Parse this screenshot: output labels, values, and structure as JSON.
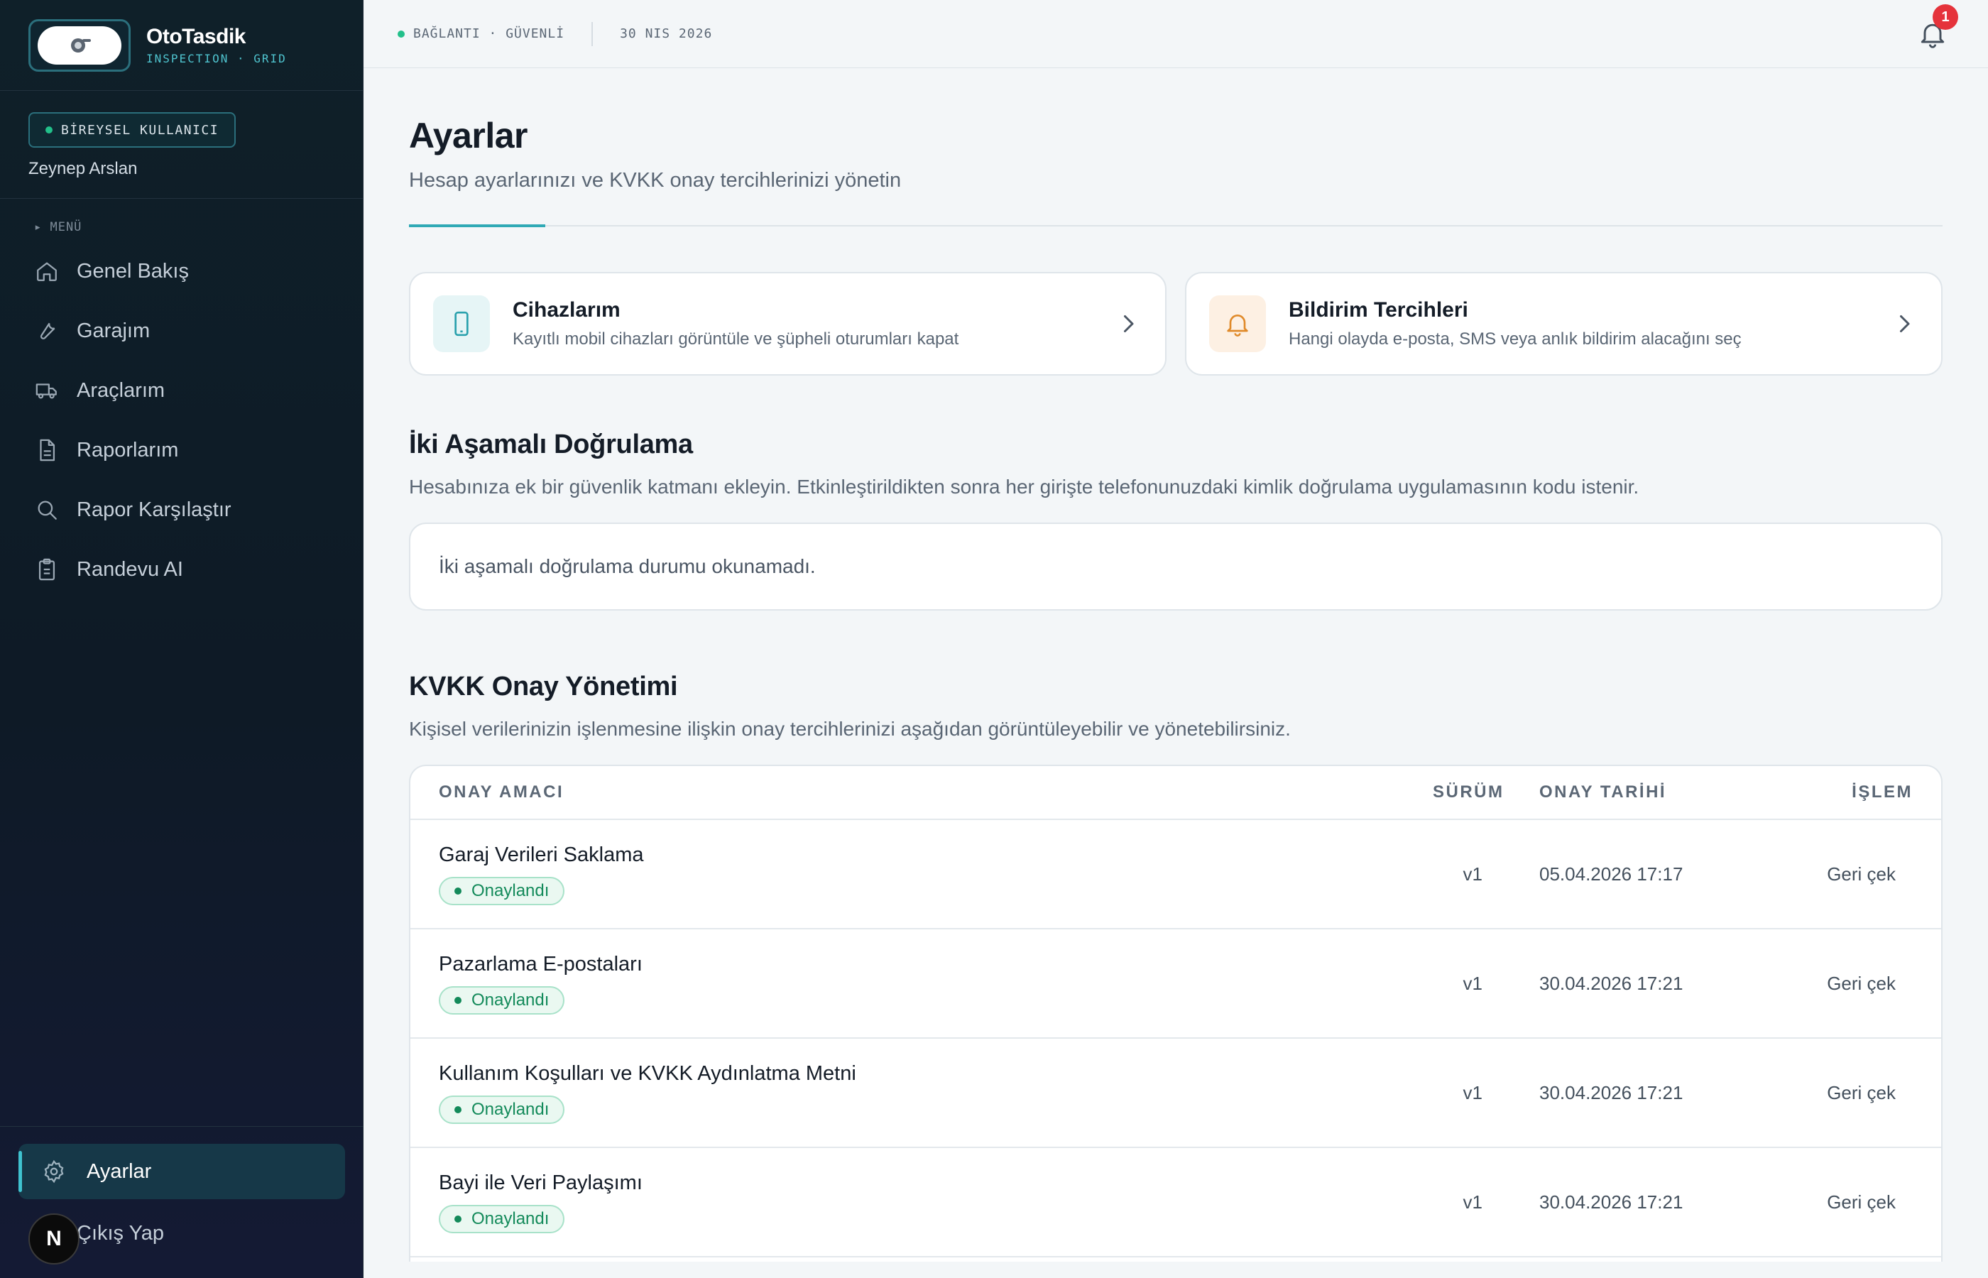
{
  "brand": {
    "name": "OtoTasdik",
    "tagline": "INSPECTION · GRID"
  },
  "user": {
    "role": "BİREYSEL KULLANICI",
    "name": "Zeynep Arslan"
  },
  "menu": {
    "label": "▸ MENÜ",
    "items": [
      {
        "label": "Genel Bakış",
        "icon": "home-icon"
      },
      {
        "label": "Garajım",
        "icon": "wrench-icon"
      },
      {
        "label": "Araçlarım",
        "icon": "truck-icon"
      },
      {
        "label": "Raporlarım",
        "icon": "document-icon"
      },
      {
        "label": "Rapor Karşılaştır",
        "icon": "search-icon"
      },
      {
        "label": "Randevu AI",
        "icon": "clipboard-icon"
      }
    ]
  },
  "sidebar_bottom": {
    "settings": "Ayarlar",
    "logout": "Çıkış Yap",
    "badge": "N"
  },
  "topbar": {
    "connection": "BAĞLANTI · GÜVENLİ",
    "date": "30 NIS 2026",
    "notifications": "1"
  },
  "page": {
    "title": "Ayarlar",
    "subtitle": "Hesap ayarlarınızı ve KVKK onay tercihlerinizi yönetin"
  },
  "cards": [
    {
      "title": "Cihazlarım",
      "desc": "Kayıtlı mobil cihazları görüntüle ve şüpheli oturumları kapat",
      "icon": "phone-icon"
    },
    {
      "title": "Bildirim Tercihleri",
      "desc": "Hangi olayda e-posta, SMS veya anlık bildirim alacağını seç",
      "icon": "bell-icon"
    }
  ],
  "two_factor": {
    "title": "İki Aşamalı Doğrulama",
    "subtitle": "Hesabınıza ek bir güvenlik katmanı ekleyin. Etkinleştirildikten sonra her girişte telefonunuzdaki kimlik doğrulama uygulamasının kodu istenir.",
    "status": "İki aşamalı doğrulama durumu okunamadı."
  },
  "kvkk": {
    "title": "KVKK Onay Yönetimi",
    "subtitle": "Kişisel verilerinizin işlenmesine ilişkin onay tercihlerinizi aşağıdan görüntüleyebilir ve yönetebilirsiniz.",
    "columns": {
      "purpose": "ONAY AMACI",
      "version": "SÜRÜM",
      "date": "ONAY TARİHİ",
      "action": "İŞLEM"
    },
    "rows": [
      {
        "purpose": "Garaj Verileri Saklama",
        "status": "Onaylandı",
        "version": "v1",
        "date": "05.04.2026 17:17",
        "action": "Geri çek"
      },
      {
        "purpose": "Pazarlama E-postaları",
        "status": "Onaylandı",
        "version": "v1",
        "date": "30.04.2026 17:21",
        "action": "Geri çek"
      },
      {
        "purpose": "Kullanım Koşulları ve KVKK Aydınlatma Metni",
        "status": "Onaylandı",
        "version": "v1",
        "date": "30.04.2026 17:21",
        "action": "Geri çek"
      },
      {
        "purpose": "Bayi ile Veri Paylaşımı",
        "status": "Onaylandı",
        "version": "v1",
        "date": "30.04.2026 17:21",
        "action": "Geri çek"
      }
    ]
  }
}
